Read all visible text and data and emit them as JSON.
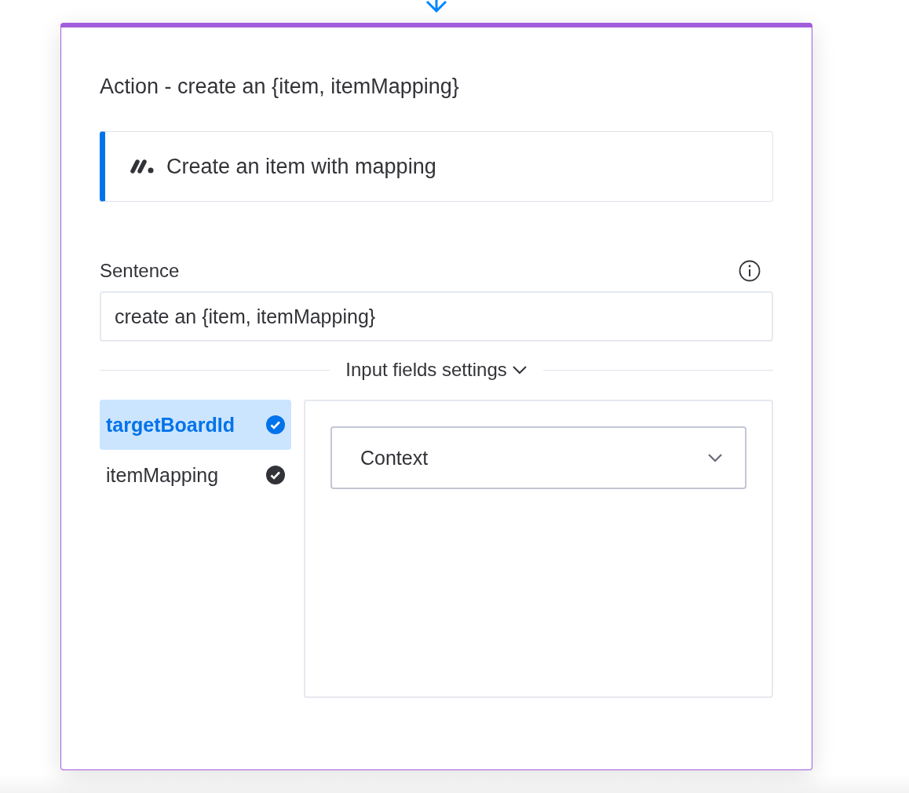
{
  "title": "Action - create an {item, itemMapping}",
  "block": {
    "label": "Create an item with mapping"
  },
  "sentence": {
    "label": "Sentence",
    "value": "create an {item, itemMapping}"
  },
  "section": {
    "label": "Input fields settings",
    "expanded": true
  },
  "fields": [
    {
      "label": "targetBoardId",
      "selected": true
    },
    {
      "label": "itemMapping",
      "selected": false
    }
  ],
  "source_select": {
    "value": "Context"
  }
}
